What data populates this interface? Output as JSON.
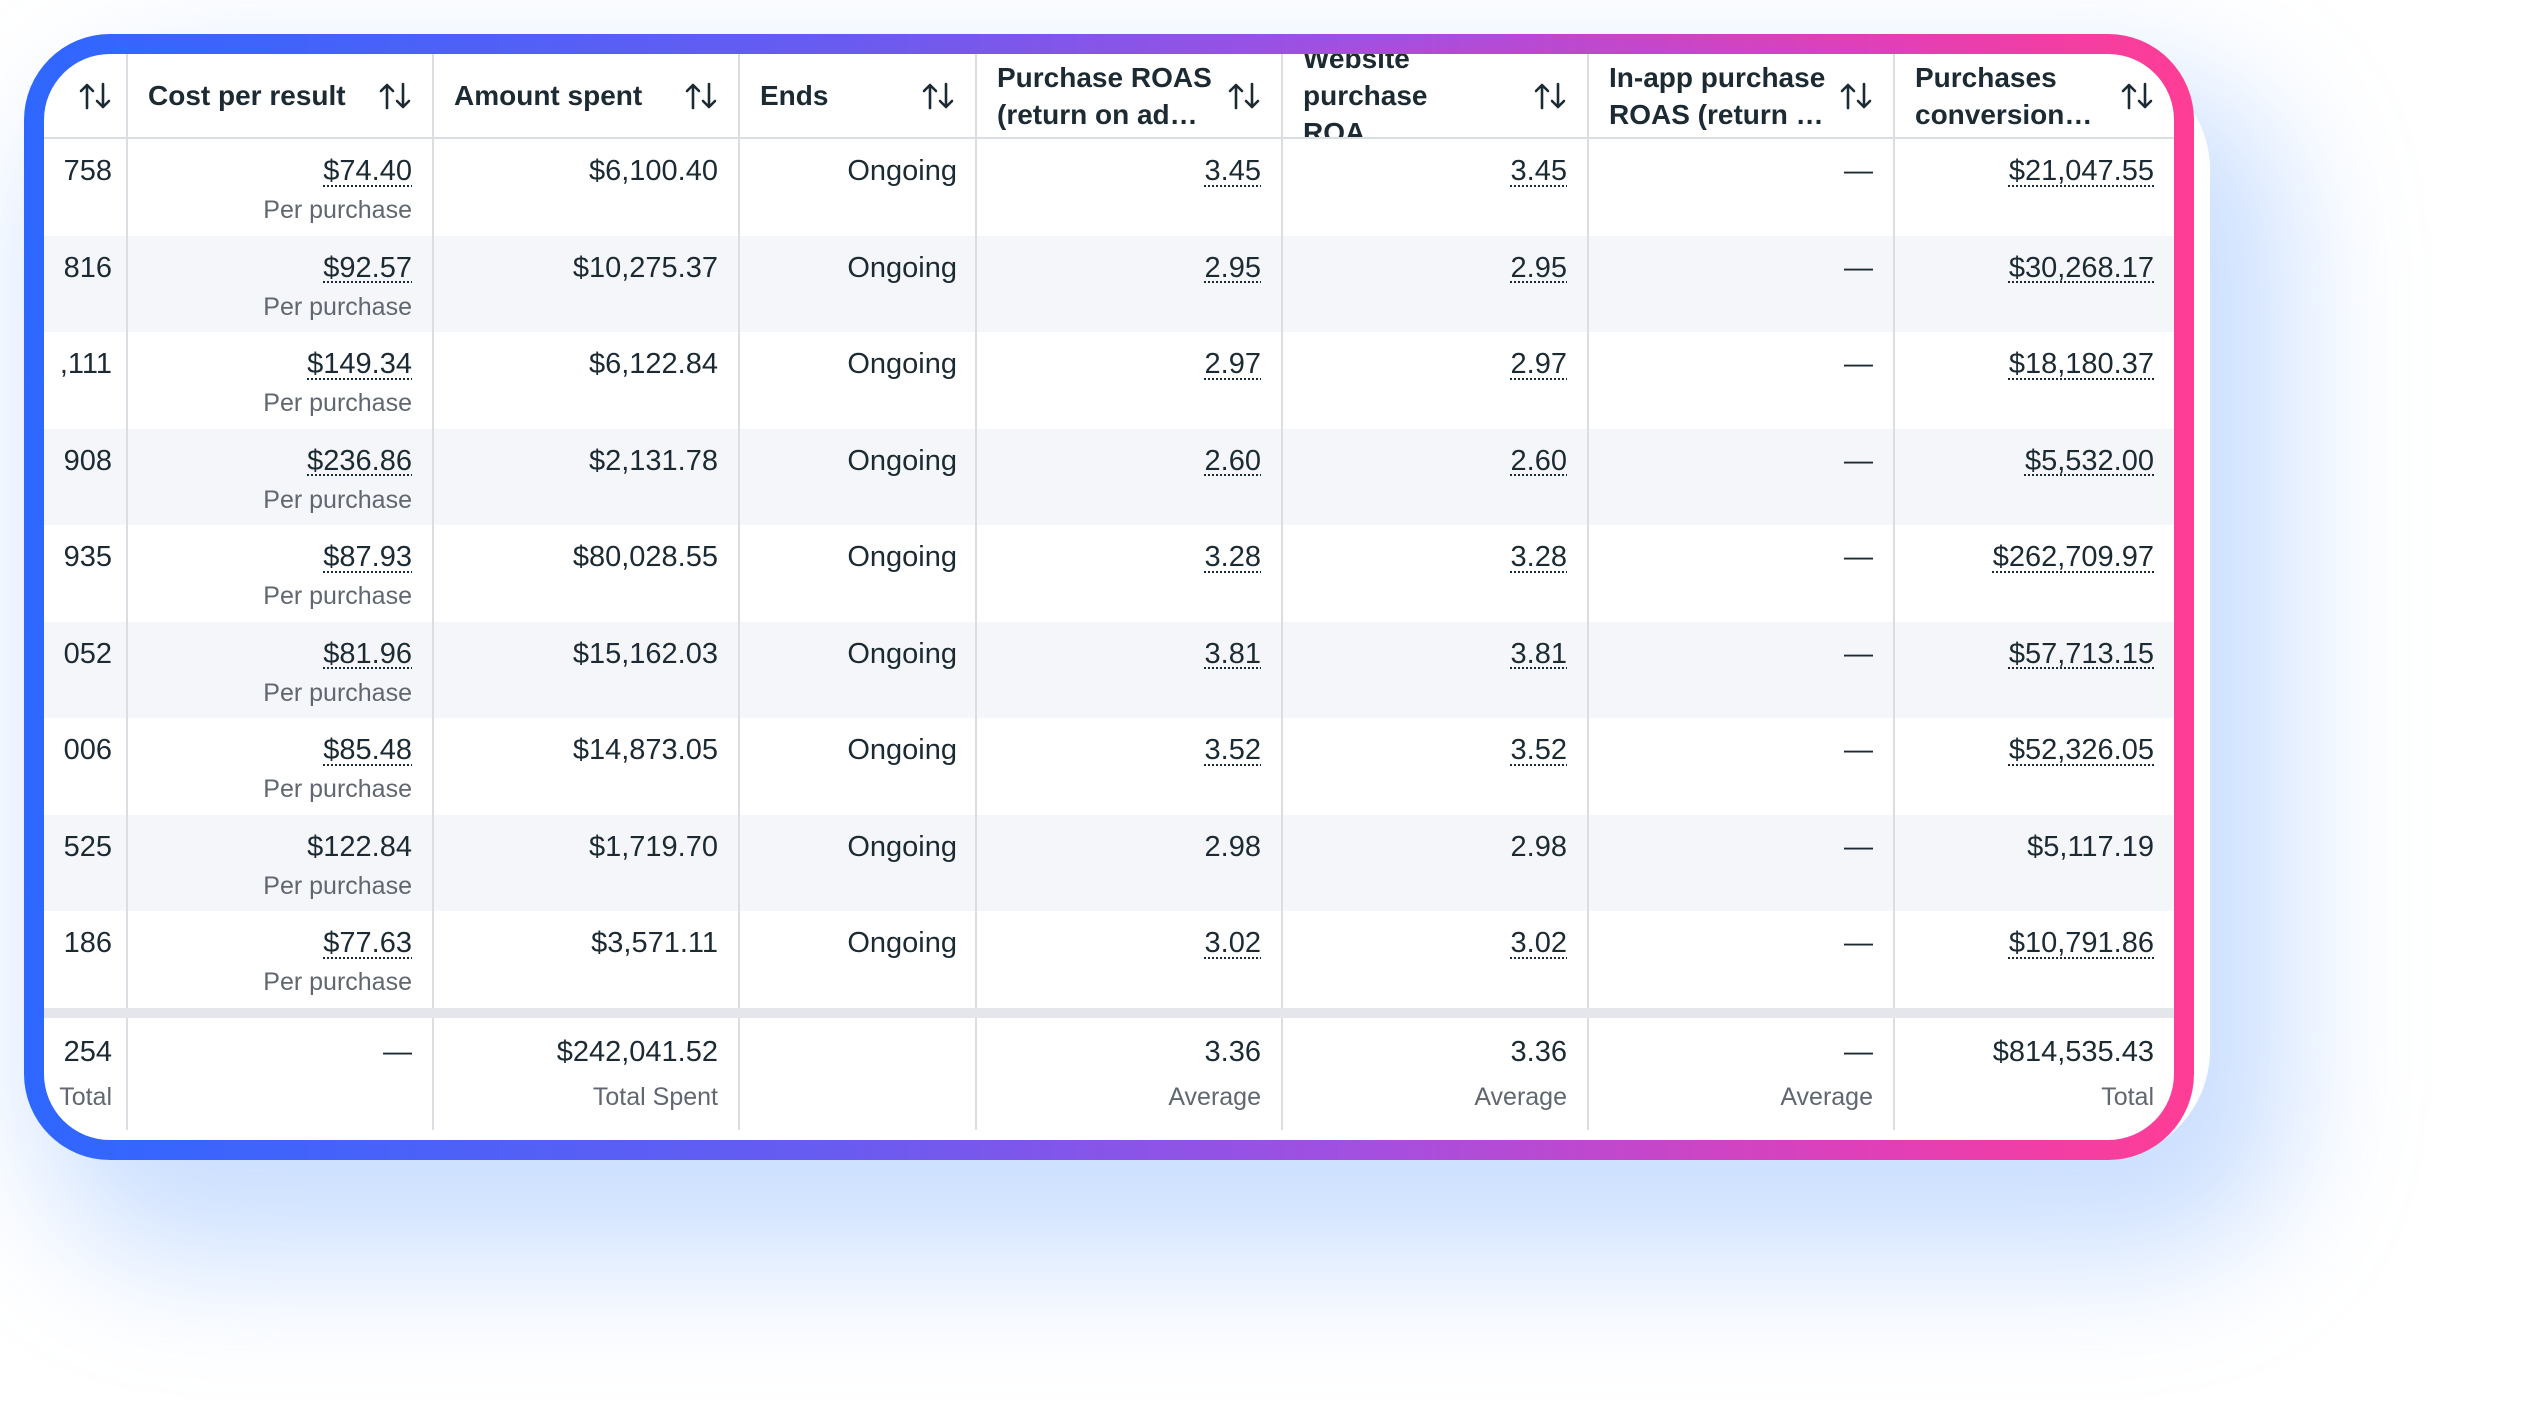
{
  "columns": [
    {
      "label": ""
    },
    {
      "label": "Cost per result"
    },
    {
      "label": "Amount spent"
    },
    {
      "label": "Ends"
    },
    {
      "label": "Purchase ROAS (return on ad…"
    },
    {
      "label": "Website purchase ROA…"
    },
    {
      "label": "In-app purchase ROAS (return …"
    },
    {
      "label": "Purchases conversion…"
    }
  ],
  "rows": [
    {
      "c0": "758",
      "cost": "$74.40",
      "cost_sub": "Per purchase",
      "spent": "$6,100.40",
      "ends": "Ongoing",
      "roas": "3.45",
      "web_roas": "3.45",
      "inapp": "—",
      "conv": "$21,047.55"
    },
    {
      "c0": "816",
      "cost": "$92.57",
      "cost_sub": "Per purchase",
      "spent": "$10,275.37",
      "ends": "Ongoing",
      "roas": "2.95",
      "web_roas": "2.95",
      "inapp": "—",
      "conv": "$30,268.17"
    },
    {
      "c0": ",111",
      "cost": "$149.34",
      "cost_sub": "Per purchase",
      "spent": "$6,122.84",
      "ends": "Ongoing",
      "roas": "2.97",
      "web_roas": "2.97",
      "inapp": "—",
      "conv": "$18,180.37"
    },
    {
      "c0": "908",
      "cost": "$236.86",
      "cost_sub": "Per purchase",
      "spent": "$2,131.78",
      "ends": "Ongoing",
      "roas": "2.60",
      "web_roas": "2.60",
      "inapp": "—",
      "conv": "$5,532.00"
    },
    {
      "c0": "935",
      "cost": "$87.93",
      "cost_sub": "Per purchase",
      "spent": "$80,028.55",
      "ends": "Ongoing",
      "roas": "3.28",
      "web_roas": "3.28",
      "inapp": "—",
      "conv": "$262,709.97"
    },
    {
      "c0": "052",
      "cost": "$81.96",
      "cost_sub": "Per purchase",
      "spent": "$15,162.03",
      "ends": "Ongoing",
      "roas": "3.81",
      "web_roas": "3.81",
      "inapp": "—",
      "conv": "$57,713.15"
    },
    {
      "c0": "006",
      "cost": "$85.48",
      "cost_sub": "Per purchase",
      "spent": "$14,873.05",
      "ends": "Ongoing",
      "roas": "3.52",
      "web_roas": "3.52",
      "inapp": "—",
      "conv": "$52,326.05"
    },
    {
      "c0": "525",
      "cost": "$122.84",
      "cost_sub": "Per purchase",
      "spent": "$1,719.70",
      "ends": "Ongoing",
      "roas": "2.98",
      "web_roas": "2.98",
      "inapp": "—",
      "conv": "$5,117.19"
    },
    {
      "c0": "186",
      "cost": "$77.63",
      "cost_sub": "Per purchase",
      "spent": "$3,571.11",
      "ends": "Ongoing",
      "roas": "3.02",
      "web_roas": "3.02",
      "inapp": "—",
      "conv": "$10,791.86"
    }
  ],
  "totals": {
    "c0": "254",
    "c0_sub": "Total",
    "cost": "—",
    "spent": "$242,041.52",
    "spent_sub": "Total Spent",
    "roas": "3.36",
    "roas_sub": "Average",
    "web_roas": "3.36",
    "web_roas_sub": "Average",
    "inapp": "—",
    "inapp_sub": "Average",
    "conv": "$814,535.43",
    "conv_sub": "Total"
  },
  "icons": {
    "sort": "sort-arrows-icon"
  },
  "colors": {
    "gradient_start": "#2e67ff",
    "gradient_end": "#ff3d95",
    "row_alt": "#f5f6fa"
  }
}
